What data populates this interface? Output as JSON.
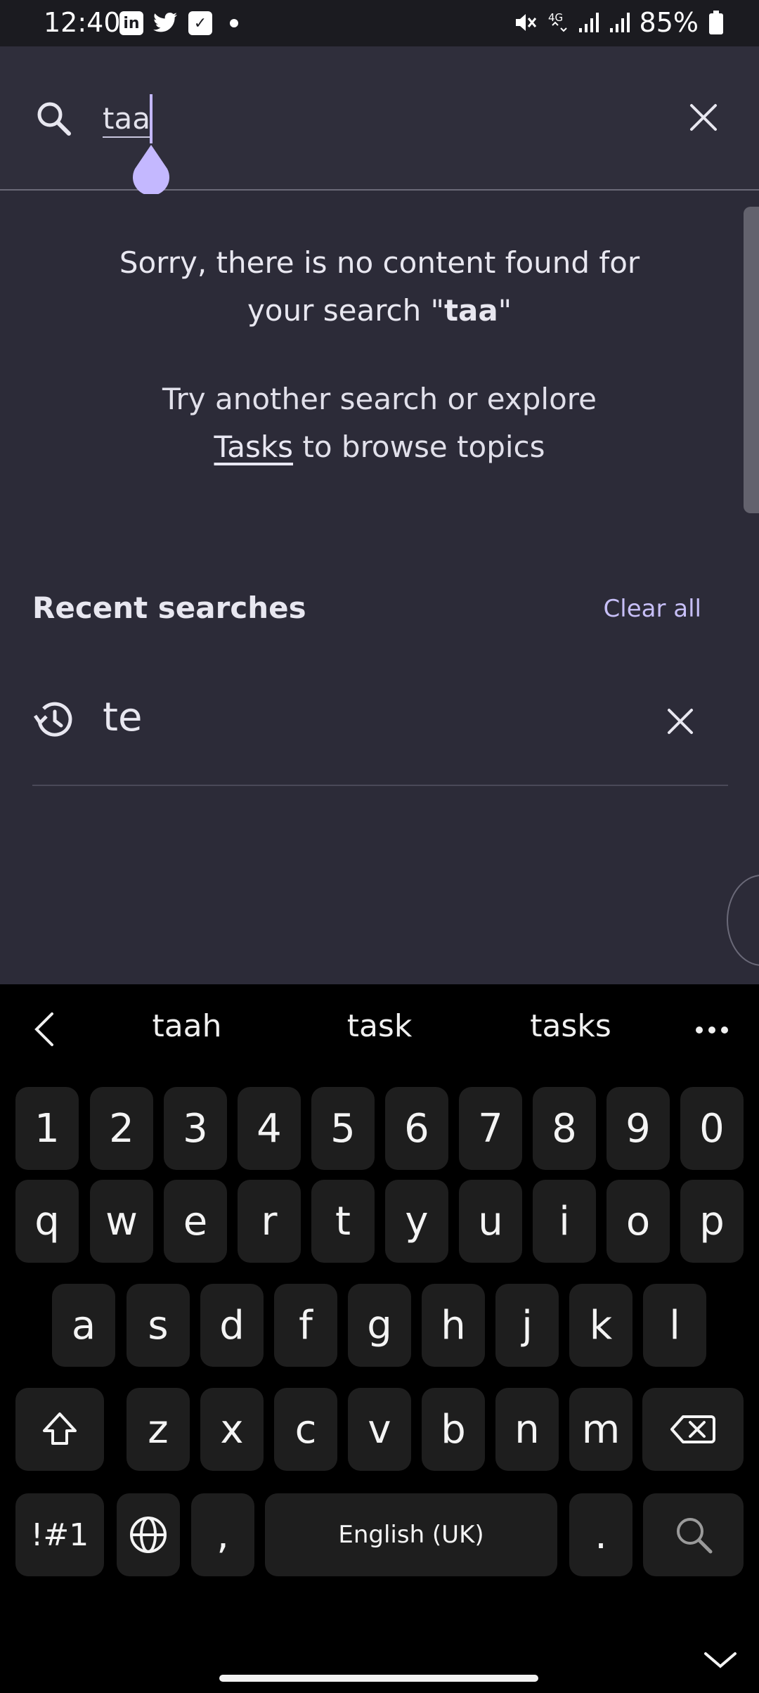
{
  "status_bar": {
    "time": "12:40",
    "battery": "85%",
    "left_icons": [
      "linkedin-icon",
      "twitter-icon",
      "checkbox-icon",
      "dot-icon"
    ],
    "right_icons": [
      "mute-icon",
      "4g-icon",
      "signal-icon",
      "signal-icon",
      "battery-icon"
    ],
    "network": "4G"
  },
  "search": {
    "value": "taa",
    "accent": "#c4b8ff"
  },
  "empty_state": {
    "line1": "Sorry, there is no content found for",
    "line2_prefix": "your search \"",
    "line2_term": "taa",
    "line2_suffix": "\"",
    "hint_prefix": "Try another search or explore",
    "hint_link": "Tasks",
    "hint_suffix": "to browse topics"
  },
  "recent": {
    "title": "Recent searches",
    "clear_all": "Clear all",
    "items": [
      "te"
    ]
  },
  "keyboard": {
    "suggestions": [
      "taah",
      "task",
      "tasks"
    ],
    "row_numbers": [
      "1",
      "2",
      "3",
      "4",
      "5",
      "6",
      "7",
      "8",
      "9",
      "0"
    ],
    "row_top": [
      "q",
      "w",
      "e",
      "r",
      "t",
      "y",
      "u",
      "i",
      "o",
      "p"
    ],
    "row_middle": [
      "a",
      "s",
      "d",
      "f",
      "g",
      "h",
      "j",
      "k",
      "l"
    ],
    "row_bottom": [
      "z",
      "x",
      "c",
      "v",
      "b",
      "n",
      "m"
    ],
    "symbols": "!#1",
    "comma": ",",
    "space": "English (UK)",
    "period": "."
  }
}
